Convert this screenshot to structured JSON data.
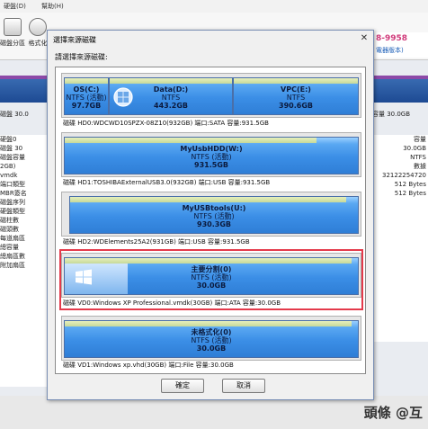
{
  "menubar": {
    "items": [
      "硬盤(D)",
      "幫助(H)"
    ]
  },
  "toolbar": {
    "items": [
      "磁盤分區",
      "格式化"
    ]
  },
  "brand": {
    "phone": "8-9958",
    "site": "電器版本)"
  },
  "background": {
    "left_info": "磁盤 30.0",
    "right_info": "容量 30.0GB",
    "left_pane_lines": [
      "硬盤0",
      "磁盤 30",
      "磁盤容量",
      "",
      "",
      "2GB)",
      "",
      "",
      "",
      "vmdk",
      "",
      "",
      "端口類型",
      "MBR簽名",
      "磁盤序列",
      "硬盤類型",
      "",
      "磁柱數",
      "磁頭數",
      "每道扇區",
      "總容量",
      "總扇區數",
      "附加扇區"
    ],
    "right_pane_lines": [
      "容量",
      "30.0GB",
      "",
      "",
      "",
      "",
      "",
      "",
      "",
      "",
      "",
      "",
      "",
      "",
      "NTFS",
      "",
      "數據",
      "",
      "",
      "32122254720",
      "512 Bytes",
      "512 Bytes"
    ]
  },
  "watermark": "頭條 @互",
  "dialog": {
    "title": "選擇來源磁碟",
    "prompt": "請選擇來源磁碟:",
    "ok_label": "確定",
    "cancel_label": "取消",
    "disks": [
      {
        "caption": "磁碟 HD0:WDCWD10SPZX-08Z10(932GB)  端口:SATA  容量:931.5GB",
        "partitions": [
          {
            "name": "OS(C:)",
            "fs": "NTFS (活動)",
            "size": "97.7GB"
          },
          {
            "name": "Data(D:)",
            "fs": "NTFS",
            "size": "443.2GB"
          },
          {
            "name": "VPC(E:)",
            "fs": "NTFS",
            "size": "390.6GB"
          }
        ]
      },
      {
        "caption": "磁碟 HD1:TOSHIBAExternalUSB3.0(932GB)  端口:USB  容量:931.5GB",
        "partitions": [
          {
            "name": "MyUsbHDD(W:)",
            "fs": "NTFS (活動)",
            "size": "931.5GB"
          }
        ]
      },
      {
        "caption": "磁碟 HD2:WDElements25A2(931GB)  端口:USB  容量:931.5GB",
        "partitions": [
          {
            "name": "MyUSBtools(U:)",
            "fs": "NTFS (活動)",
            "size": "930.3GB"
          }
        ]
      },
      {
        "caption": "磁碟 VD0:Windows XP Professional.vmdk(30GB)  端口:ATA  容量:30.0GB",
        "partitions": [
          {
            "name": "主要分割(0)",
            "fs": "NTFS (活動)",
            "size": "30.0GB"
          }
        ]
      },
      {
        "caption": "磁碟 VD1:Windows xp.vhd(30GB)  端口:File  容量:30.0GB",
        "partitions": [
          {
            "name": "未格式化(0)",
            "fs": "NTFS (活動)",
            "size": "30.0GB"
          }
        ]
      }
    ]
  }
}
